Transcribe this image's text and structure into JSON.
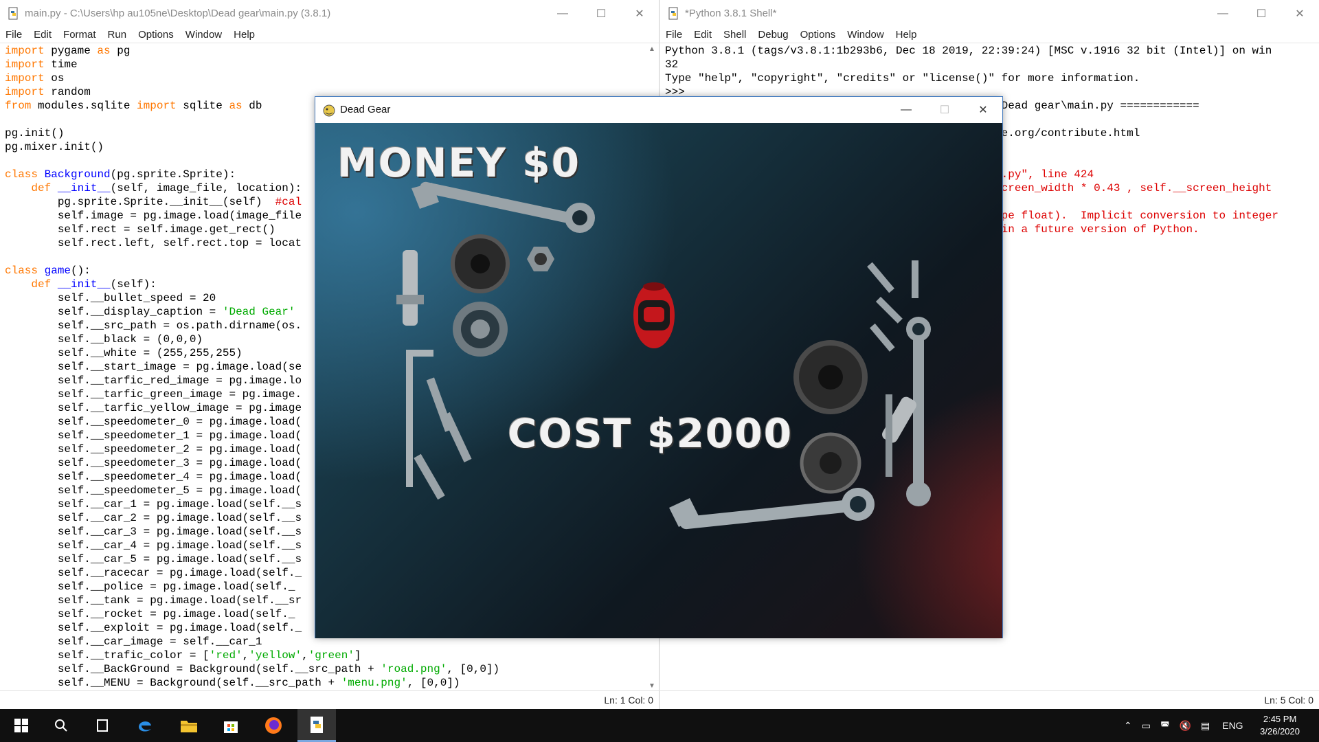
{
  "editor": {
    "title": "main.py - C:\\Users\\hp au105ne\\Desktop\\Dead gear\\main.py (3.8.1)",
    "menu": [
      "File",
      "Edit",
      "Format",
      "Run",
      "Options",
      "Window",
      "Help"
    ],
    "status": "Ln: 1   Col: 0"
  },
  "shell": {
    "title": "*Python 3.8.1 Shell*",
    "menu": [
      "File",
      "Edit",
      "Shell",
      "Debug",
      "Options",
      "Window",
      "Help"
    ],
    "status": "Ln: 5   Col: 0"
  },
  "game": {
    "title": "Dead Gear",
    "money": "MONEY $0",
    "cost": "COST $2000"
  },
  "taskbar": {
    "lang": "ENG",
    "time": "2:45 PM",
    "date": "3/26/2020"
  }
}
